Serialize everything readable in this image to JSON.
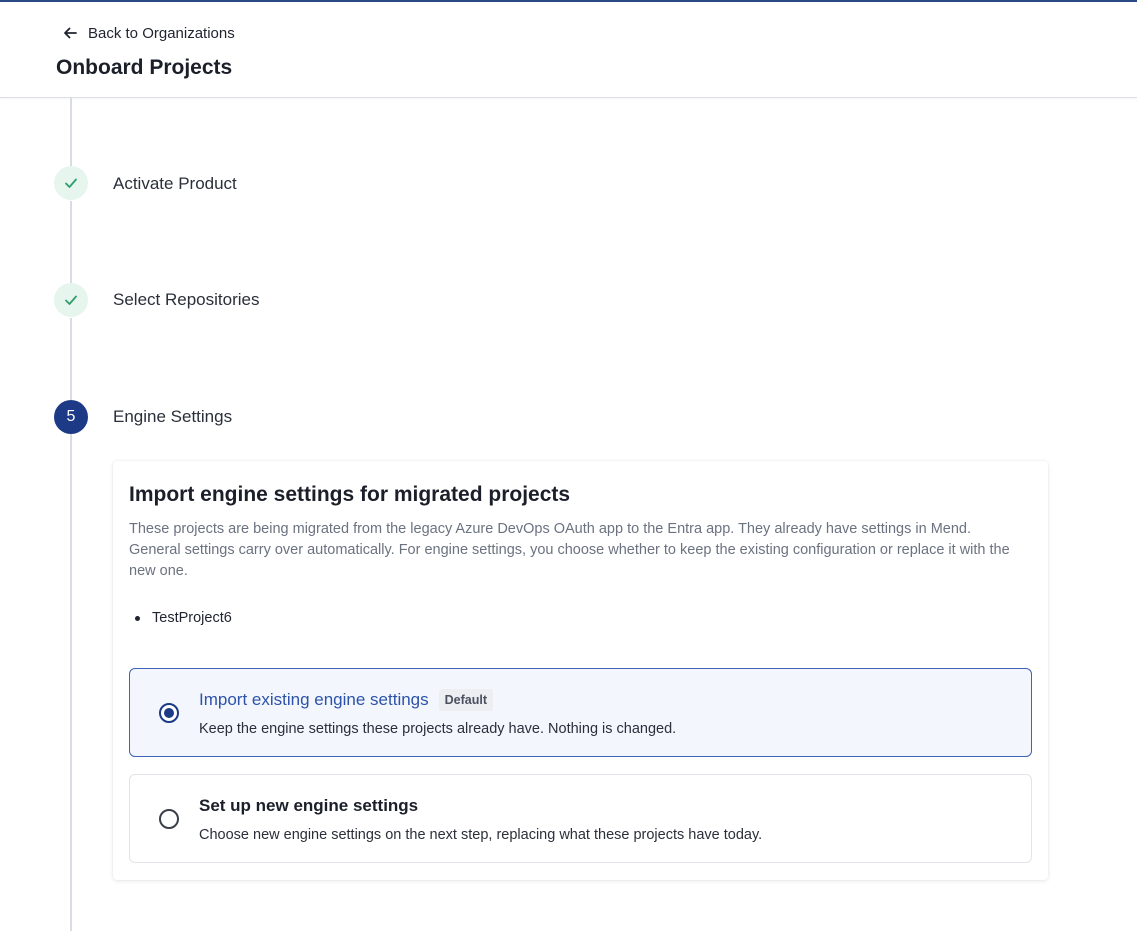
{
  "header": {
    "back_label": "Back to Organizations",
    "title": "Onboard Projects"
  },
  "steps": [
    {
      "label": "Activate Product",
      "status": "done",
      "icon": "check-icon"
    },
    {
      "label": "Select Repositories",
      "status": "done",
      "icon": "check-icon"
    },
    {
      "label": "Engine Settings",
      "status": "active",
      "number": "5"
    }
  ],
  "card": {
    "title": "Import engine settings for migrated projects",
    "description": "These projects are being migrated from the legacy Azure DevOps OAuth app to the Entra app. They already have settings in Mend. General settings carry over automatically. For engine settings, you choose whether to keep the existing configuration or replace it with the new one.",
    "projects": [
      "TestProject6"
    ],
    "options": [
      {
        "title": "Import existing engine settings",
        "badge": "Default",
        "description": "Keep the engine settings these projects already have. Nothing is changed.",
        "selected": true
      },
      {
        "title": "Set up new engine settings",
        "description": "Choose new engine settings on the next step, replacing what these projects have today.",
        "selected": false
      }
    ]
  },
  "colors": {
    "accent": "#1d3a86",
    "success_bg": "#e6f5ee",
    "success_check": "#2e9e6b",
    "selected_border": "#3e63b7"
  }
}
